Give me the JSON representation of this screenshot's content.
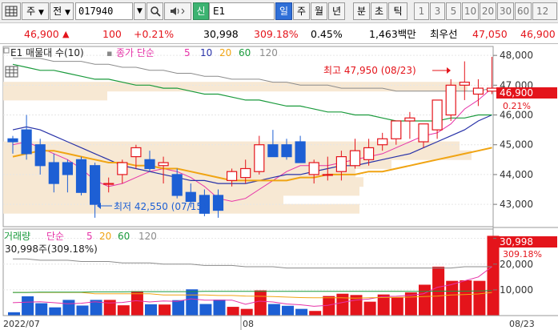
{
  "toolbar": {
    "grid_label": "주",
    "prev_label": "전",
    "code_value": "017940",
    "search_icon": "search-icon",
    "market_tag": "신",
    "name_value": "E1",
    "periods": [
      "일",
      "주",
      "월",
      "년"
    ],
    "intervals": [
      "분",
      "초",
      "틱"
    ],
    "minutes": [
      "1",
      "3",
      "5",
      "10",
      "20",
      "30",
      "60",
      "12"
    ],
    "active_period": "일"
  },
  "quote": {
    "price": "46,900",
    "change": "100",
    "change_pct": "+0.21%",
    "volume": "30,998",
    "volume_ratio": "309.18%",
    "turnover": "0.45%",
    "trade_value": "1,463백만",
    "best_offer_label": "최우선",
    "best_ask": "47,050",
    "best_bid": "46,900"
  },
  "colors": {
    "up": "#e4141b",
    "down": "#1d5fd4",
    "ma5": "#e633a8",
    "ma10": "#2832a8",
    "ma20": "#f0a413",
    "ma60": "#1a9a3c",
    "ma120": "#8c8c8c"
  },
  "price_panel": {
    "legend_title": "E1 매물대 수(10)",
    "ma_title": "종가 단순",
    "ma_periods": [
      "5",
      "10",
      "20",
      "60",
      "120"
    ],
    "high_label": "최고 47,950 (08/23)",
    "low_label": "최저 42,550 (07/15)",
    "current_tag": "46,900",
    "current_pct": "0.21%"
  },
  "volume_panel": {
    "title": "거래량",
    "ma_title": "단순",
    "ma_periods": [
      "5",
      "20",
      "60",
      "120"
    ],
    "readout": "30,998주(309.18%)",
    "current_tag": "30,998",
    "current_pct": "309.18%"
  },
  "x_labels": [
    "2022/07",
    "08",
    "08/23"
  ],
  "chart_data": [
    {
      "type": "candlestick",
      "y_ticks": [
        43000,
        44000,
        45000,
        46000,
        47000,
        48000
      ],
      "ylim": [
        42250,
        48300
      ],
      "series": [
        {
          "name": "E1",
          "ohlc": [
            [
              45200,
              45300,
              44700,
              45100
            ],
            [
              45500,
              46000,
              44500,
              44700
            ],
            [
              45000,
              45200,
              44000,
              44300
            ],
            [
              44400,
              44700,
              43400,
              43700
            ],
            [
              44400,
              44500,
              43400,
              44000
            ],
            [
              44500,
              44600,
              43300,
              43400
            ],
            [
              44300,
              44400,
              42550,
              43000
            ],
            [
              43700,
              43900,
              43400,
              43700
            ],
            [
              44000,
              44500,
              43700,
              44400
            ],
            [
              44600,
              45000,
              44200,
              44900
            ],
            [
              44500,
              44800,
              44100,
              44200
            ],
            [
              44300,
              44600,
              43700,
              44400
            ],
            [
              44000,
              44200,
              43200,
              43300
            ],
            [
              43400,
              43700,
              42900,
              43100
            ],
            [
              43300,
              43500,
              42600,
              42700
            ],
            [
              43300,
              43500,
              42550,
              42800
            ],
            [
              43800,
              44200,
              43600,
              44100
            ],
            [
              43900,
              44500,
              43700,
              44200
            ],
            [
              44100,
              45300,
              44000,
              45000
            ],
            [
              45000,
              45500,
              44700,
              44600
            ],
            [
              45000,
              45200,
              44500,
              44600
            ],
            [
              45100,
              45300,
              44400,
              44400
            ],
            [
              44000,
              44500,
              43700,
              44400
            ],
            [
              44000,
              44600,
              43800,
              44000
            ],
            [
              44100,
              44800,
              43800,
              44600
            ],
            [
              44300,
              45200,
              44200,
              44800
            ],
            [
              44500,
              45200,
              44300,
              44900
            ],
            [
              45000,
              45400,
              44800,
              45200
            ],
            [
              45200,
              45800,
              45000,
              45800
            ],
            [
              45800,
              46100,
              45200,
              45900
            ],
            [
              45100,
              45300,
              44900,
              45700
            ],
            [
              45500,
              46400,
              45200,
              46500
            ],
            [
              46000,
              47200,
              45800,
              47000
            ],
            [
              47000,
              47800,
              46500,
              47100
            ],
            [
              46700,
              47200,
              46300,
              46900
            ],
            [
              46800,
              47950,
              46700,
              46900
            ]
          ]
        },
        {
          "name": "5",
          "values": [
            45000,
            45100,
            44900,
            44700,
            44500,
            44200,
            43800,
            43600,
            43700,
            43900,
            44100,
            44200,
            44100,
            43900,
            43600,
            43200,
            43100,
            43200,
            43500,
            43800,
            44100,
            44300,
            44300,
            44300,
            44400,
            44500,
            44600,
            44700,
            44900,
            45100,
            45300,
            45400,
            45700,
            46200,
            46500,
            46900
          ]
        },
        {
          "name": "10",
          "values": [
            45500,
            45600,
            45500,
            45300,
            45100,
            44900,
            44700,
            44500,
            44300,
            44200,
            44100,
            44000,
            43900,
            43800,
            43800,
            43700,
            43700,
            43700,
            43800,
            43900,
            44000,
            44000,
            44100,
            44200,
            44300,
            44300,
            44400,
            44500,
            44600,
            44700,
            44900,
            45100,
            45300,
            45500,
            45800,
            46000
          ]
        },
        {
          "name": "20",
          "values": [
            44600,
            44700,
            44800,
            44800,
            44700,
            44600,
            44500,
            44400,
            44400,
            44300,
            44300,
            44200,
            44200,
            44100,
            44000,
            43900,
            43800,
            43800,
            43800,
            43800,
            43800,
            43900,
            43900,
            44000,
            44000,
            44000,
            44100,
            44100,
            44200,
            44300,
            44400,
            44500,
            44600,
            44700,
            44800,
            44900
          ]
        },
        {
          "name": "60",
          "values": [
            47700,
            47600,
            47500,
            47500,
            47400,
            47300,
            47200,
            47200,
            47100,
            47000,
            47000,
            46900,
            46900,
            46800,
            46700,
            46700,
            46600,
            46500,
            46500,
            46400,
            46300,
            46300,
            46200,
            46100,
            46100,
            46000,
            46000,
            45900,
            45800,
            45800,
            45800,
            45800,
            45900,
            45900,
            46000,
            46000
          ]
        },
        {
          "name": "120",
          "values": [
            47900,
            47900,
            47900,
            47800,
            47800,
            47800,
            47700,
            47700,
            47600,
            47600,
            47500,
            47500,
            47400,
            47400,
            47300,
            47300,
            47200,
            47200,
            47200,
            47100,
            47100,
            47000,
            47000,
            47000,
            46900,
            46900,
            46900,
            46900,
            46800,
            46800,
            46800,
            46800,
            46800,
            46800,
            46800,
            46900
          ]
        }
      ]
    },
    {
      "type": "bar",
      "y_ticks": [
        10000,
        20000,
        30000
      ],
      "ylim": [
        0,
        33000
      ],
      "series": [
        {
          "name": "거래량",
          "values": [
            1300,
            7500,
            4800,
            3200,
            6100,
            3900,
            6100,
            6100,
            4000,
            9500,
            4400,
            4300,
            6000,
            10200,
            4500,
            6200,
            3400,
            2600,
            9800,
            4500,
            3800,
            2600,
            1800,
            7600,
            8500,
            8000,
            5400,
            8200,
            7100,
            9000,
            12000,
            19000,
            13500,
            13700,
            13500,
            30998
          ]
        },
        {
          "name": "5",
          "values": [
            5000,
            5200,
            5400,
            5000,
            4600,
            4800,
            5400,
            4900,
            5100,
            5800,
            5300,
            5700,
            5500,
            6500,
            6000,
            6000,
            6000,
            4400,
            5600,
            5300,
            4500,
            4200,
            3600,
            4000,
            5000,
            6000,
            6400,
            7400,
            7500,
            7900,
            8500,
            11000,
            12000,
            13500,
            15000,
            19000
          ]
        },
        {
          "name": "20",
          "values": [
            9000,
            9000,
            9000,
            9000,
            9000,
            9000,
            8500,
            8500,
            8500,
            8500,
            8500,
            8000,
            8000,
            8000,
            8000,
            7800,
            7800,
            7600,
            7500,
            7400,
            7200,
            7000,
            6900,
            6900,
            6900,
            6800,
            6900,
            7000,
            7100,
            7200,
            7400,
            7600,
            8000,
            8200,
            8400,
            9000
          ]
        },
        {
          "name": "60",
          "values": [
            9000,
            9000,
            9100,
            9100,
            9100,
            9100,
            9200,
            9200,
            9200,
            9300,
            9300,
            9300,
            9300,
            9300,
            9400,
            9400,
            9400,
            9400,
            9400,
            9400,
            9400,
            9400,
            9400,
            9400,
            9400,
            9400,
            9400,
            9400,
            9400,
            9400,
            9400,
            9500,
            9500,
            9500,
            9600,
            9700
          ]
        },
        {
          "name": "120",
          "values": [
            22000,
            22000,
            21500,
            21500,
            21500,
            21000,
            21000,
            21000,
            20500,
            20500,
            20500,
            20000,
            20000,
            20000,
            19500,
            19500,
            19500,
            19000,
            19000,
            19000,
            18500,
            18500,
            18500,
            18500,
            18500,
            18500,
            18500,
            18500,
            18500,
            18500,
            18500,
            18500,
            18500,
            19000,
            19000,
            19000
          ]
        }
      ]
    }
  ]
}
